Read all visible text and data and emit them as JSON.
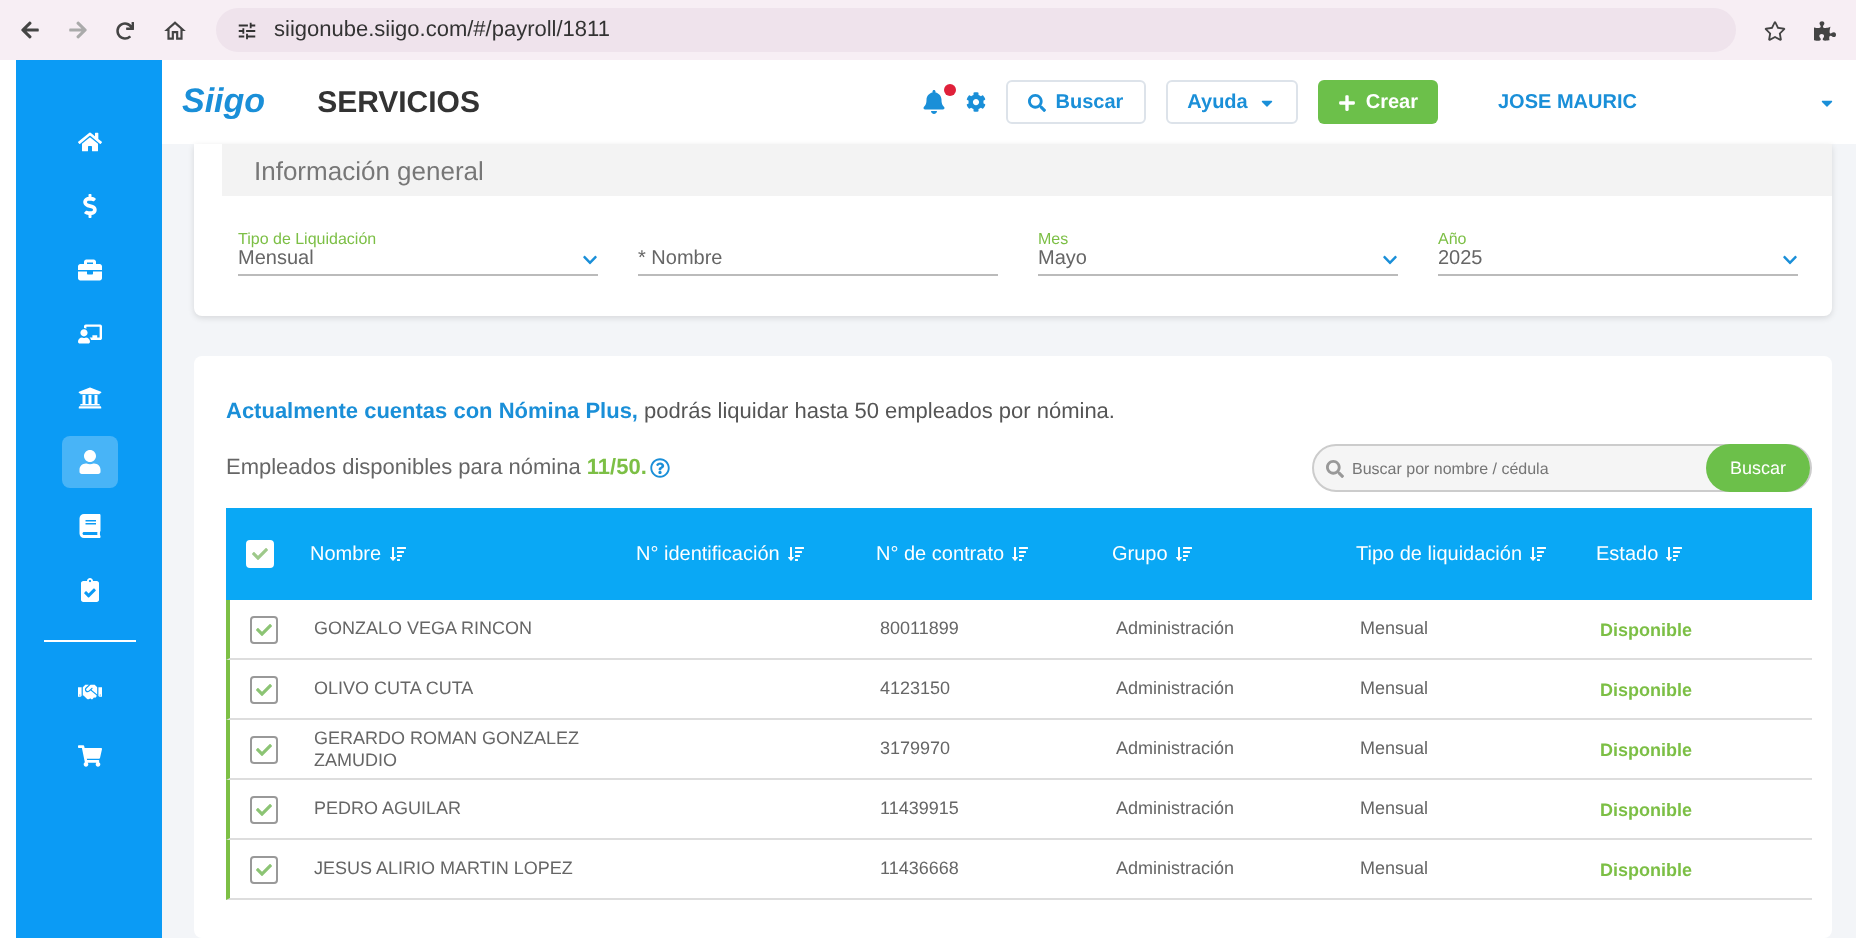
{
  "browser": {
    "url": "siigonube.siigo.com/#/payroll/1811"
  },
  "sidebar": {
    "items": [
      {
        "selected": false
      },
      {
        "selected": false
      },
      {
        "selected": false
      },
      {
        "selected": false
      },
      {
        "selected": false
      },
      {
        "selected": true
      },
      {
        "selected": false
      },
      {
        "selected": false
      },
      {
        "selected": false
      },
      {
        "selected": false
      }
    ]
  },
  "header": {
    "logo": "Siigo",
    "title": "SERVICIOS",
    "notification": true,
    "search_button": "Buscar",
    "help_button": "Ayuda",
    "create_button": "Crear",
    "user": "JOSE MAURIC"
  },
  "general_info": {
    "title": "Información general",
    "fields": [
      {
        "label": "Tipo de Liquidación",
        "value": "Mensual",
        "kind": "select"
      },
      {
        "placeholder": "* Nombre",
        "kind": "text"
      },
      {
        "label": "Mes",
        "value": "Mayo",
        "kind": "select"
      },
      {
        "label": "Año",
        "value": "2025",
        "kind": "select"
      }
    ]
  },
  "employees": {
    "plan_notice": "**Actualmente cuentas con Nómina Plus,** podrás liquidar hasta 50 empleados por nómina.",
    "available_label": "Empleados disponibles para nómina",
    "available_count": "11/50.",
    "search": {
      "placeholder": "Buscar por nombre / cédula",
      "button": "Buscar"
    },
    "table": {
      "all_checked": true,
      "columns": [
        "Nombre",
        "N° identificación",
        "N° de contrato",
        "Grupo",
        "Tipo de liquidación",
        "Estado"
      ],
      "rows": [
        {
          "checked": true,
          "name": "GONZALO VEGA RINCON",
          "contract": "80011899",
          "group": "Administración",
          "type": "Mensual",
          "status": "Disponible"
        },
        {
          "checked": true,
          "name": "OLIVO CUTA CUTA",
          "contract": "4123150",
          "group": "Administración",
          "type": "Mensual",
          "status": "Disponible"
        },
        {
          "checked": true,
          "name": "GERARDO ROMAN GONZALEZ ZAMUDIO",
          "contract": "3179970",
          "group": "Administración",
          "type": "Mensual",
          "status": "Disponible"
        },
        {
          "checked": true,
          "name": "PEDRO AGUILAR",
          "contract": "11439915",
          "group": "Administración",
          "type": "Mensual",
          "status": "Disponible"
        },
        {
          "checked": true,
          "name": "JESUS ALIRIO MARTIN LOPEZ",
          "contract": "11436668",
          "group": "Administración",
          "type": "Mensual",
          "status": "Disponible"
        }
      ]
    }
  }
}
